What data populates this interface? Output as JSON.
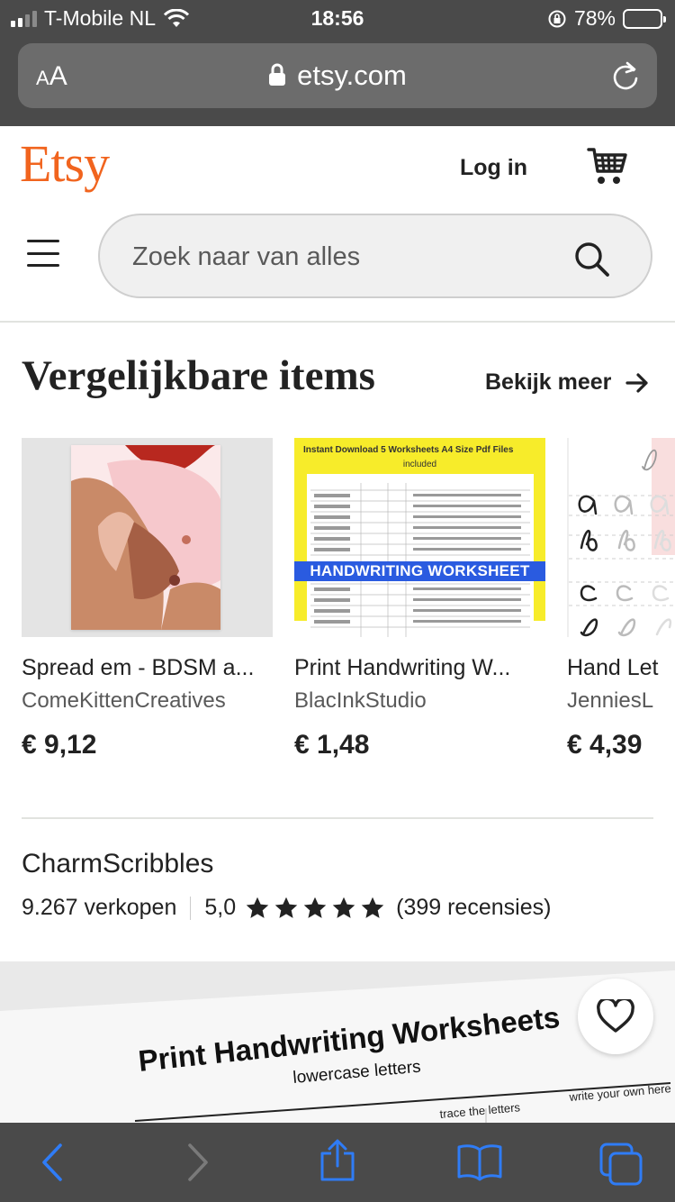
{
  "status_bar": {
    "carrier": "T-Mobile NL",
    "time": "18:56",
    "battery_percent": "78%",
    "battery_level": 0.78
  },
  "browser": {
    "text_size_button": "AA",
    "domain": "etsy.com"
  },
  "header": {
    "logo": "Etsy",
    "login_label": "Log in",
    "search_placeholder": "Zoek naar van alles"
  },
  "similar": {
    "title": "Vergelijkbare items",
    "see_more": "Bekijk meer",
    "items": [
      {
        "title": "Spread em - BDSM a...",
        "shop": "ComeKittenCreatives",
        "price": "€ 9,12"
      },
      {
        "title": "Print Handwriting W...",
        "shop": "BlacInkStudio",
        "price": "€ 1,48",
        "thumb_top": "Instant Download   5 Worksheets   A4 Size   Pdf Files",
        "thumb_sub": "included",
        "thumb_banner": "HANDWRITING WORKSHEET"
      },
      {
        "title": "Hand Let",
        "shop": "JenniesL",
        "price": "€ 4,39"
      }
    ]
  },
  "shop": {
    "name": "CharmScribbles",
    "sales": "9.267 verkopen",
    "rating": "5,0",
    "rating_value": 5,
    "reviews": "(399 recensies)"
  },
  "hero": {
    "heading": "Print Handwriting Worksheets",
    "subheading": "lowercase letters",
    "note_left": "trace the letters",
    "note_right": "write your own here"
  },
  "colors": {
    "brand": "#f1641e",
    "chrome": "#4a4a4a",
    "ios_blue": "#2f7cf6",
    "worksheet_yellow": "#f7ec2a",
    "worksheet_blue": "#2a5be0"
  },
  "icons": [
    "lock-icon",
    "reload-icon",
    "cart-icon",
    "menu-icon",
    "search-icon",
    "arrow-right-icon",
    "star-icon",
    "heart-icon",
    "back-icon",
    "forward-icon",
    "share-icon",
    "bookmarks-icon",
    "tabs-icon"
  ]
}
